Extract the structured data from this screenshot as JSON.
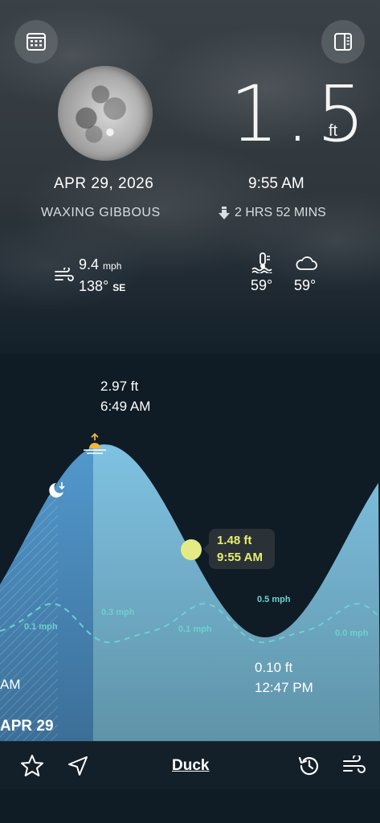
{
  "header": {
    "calendar_button": "calendar-icon",
    "panel_button": "sidebar-icon"
  },
  "moon": {
    "date": "APR 29, 2026",
    "phase": "WAXING GIBBOUS"
  },
  "current": {
    "height_value": "1.5",
    "height_unit": "ft",
    "time": "9:55 AM",
    "countdown": "2 HRS 52 MINS",
    "countdown_icon": "arrow-down-icon"
  },
  "weather": {
    "wind_speed": "9.4",
    "wind_speed_unit": "mph",
    "wind_direction_deg": "138°",
    "wind_direction_card": "SE",
    "water_temp": "59°",
    "air_temp": "59°",
    "water_icon": "water-thermometer-icon",
    "air_icon": "cloud-icon"
  },
  "tide_chart": {
    "high": {
      "height": "2.97 ft",
      "time": "6:49 AM"
    },
    "low": {
      "height": "0.10 ft",
      "time": "12:47 PM"
    },
    "cursor": {
      "height": "1.48 ft",
      "time": "9:55 AM"
    },
    "prev_label_fragment": "AM",
    "day_label": "APR 29",
    "wind_labels": [
      "0.1 mph",
      "0.3 mph",
      "0.1 mph",
      "0.5 mph",
      "0.0 mph"
    ],
    "colors": {
      "water": "#7fbfdc",
      "past": "#4f98cf",
      "cursor": "#e4ea86",
      "wind_line": "#6fd0d0"
    }
  },
  "bottom_bar": {
    "station": "Duck",
    "favorite_icon": "star-icon",
    "location_icon": "location-arrow-icon",
    "history_icon": "history-icon",
    "wind_icon": "wind-icon"
  }
}
